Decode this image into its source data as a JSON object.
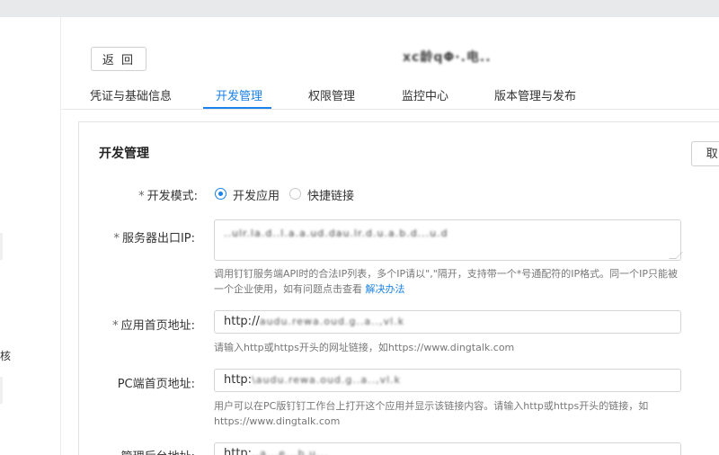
{
  "header": {
    "back_label": "返 回",
    "app_name": "xc龄qΦ·.电.."
  },
  "left": {
    "fragment": "核"
  },
  "tabs": [
    {
      "label": "凭证与基础信息"
    },
    {
      "label": "开发管理"
    },
    {
      "label": "权限管理"
    },
    {
      "label": "监控中心"
    },
    {
      "label": "版本管理与发布"
    }
  ],
  "card": {
    "title": "开发管理",
    "cancel_label": "取 消"
  },
  "form": {
    "dev_mode": {
      "required": "*",
      "label": "开发模式:",
      "options": [
        "开发应用",
        "快捷链接"
      ]
    },
    "server_ip": {
      "required": "*",
      "label": "服务器出口IP:",
      "value": "..ulr.la.d..l.a.a.ud.dau.lr.d.u.a.b.d...u.d",
      "help": "调用钉钉服务端API时的合法IP列表，多个IP请以\",\"隔开，支持带一个*号通配符的IP格式。同一个IP只能被一个企业使用，如有问题点击查看 ",
      "help_link": "解决办法"
    },
    "home_url": {
      "required": "*",
      "label": "应用首页地址:",
      "prefix": "http://",
      "value": "audu.rewa.oud.g..a..,vl.k",
      "help": "请输入http或https开头的网址链接，如https://www.dingtalk.com"
    },
    "pc_url": {
      "label": "PC端首页地址:",
      "prefix": "http:",
      "value": "\\audu.rewa.oud.g..a..,vl.k",
      "help": "用户可以在PC版钉钉工作台上打开这个应用并显示该链接内容。请输入http或https开头的链接，如https://www.dingtalk.com"
    },
    "admin_url": {
      "label": "管理后台地址:",
      "prefix": "http:",
      "value": "..a...e...b.u..."
    }
  }
}
